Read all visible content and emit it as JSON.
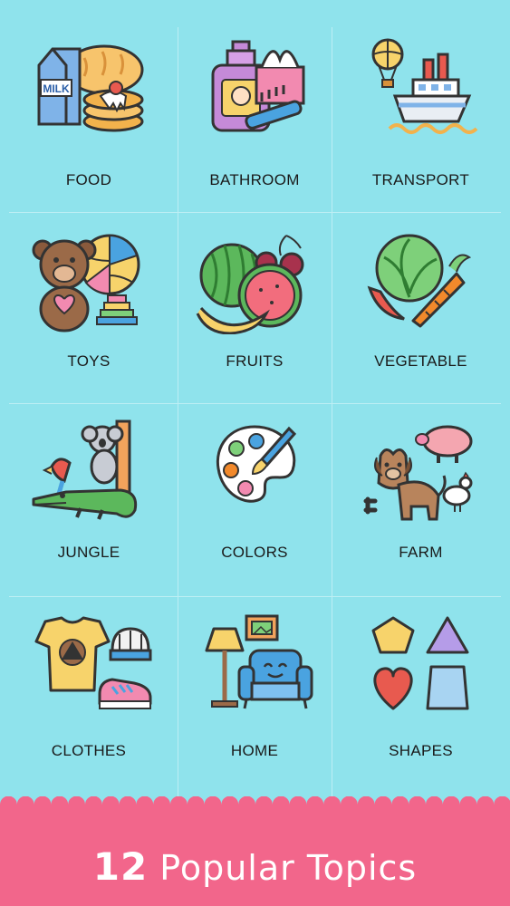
{
  "topics": [
    {
      "label": "FOOD",
      "icon": "milk-bread-pancake-icon"
    },
    {
      "label": "BATHROOM",
      "icon": "soap-tissue-brush-icon"
    },
    {
      "label": "TRANSPORT",
      "icon": "ship-balloon-icon"
    },
    {
      "label": "TOYS",
      "icon": "teddy-ball-stacker-icon"
    },
    {
      "label": "FRUITS",
      "icon": "watermelon-banana-berry-icon"
    },
    {
      "label": "VEGETABLE",
      "icon": "cabbage-carrot-pepper-icon"
    },
    {
      "label": "JUNGLE",
      "icon": "crocodile-koala-parrot-icon"
    },
    {
      "label": "COLORS",
      "icon": "paint-palette-icon"
    },
    {
      "label": "FARM",
      "icon": "dog-pig-chicken-icon"
    },
    {
      "label": "CLOTHES",
      "icon": "tshirt-beanie-sneaker-icon"
    },
    {
      "label": "HOME",
      "icon": "lamp-armchair-picture-icon"
    },
    {
      "label": "SHAPES",
      "icon": "pentagon-triangle-heart-trapezoid-icon"
    }
  ],
  "footer": {
    "count": "12",
    "text": "Popular Topics"
  },
  "colors": {
    "background": "#8fe3ec",
    "footer": "#f2668b",
    "divider": "#bdeff4"
  }
}
